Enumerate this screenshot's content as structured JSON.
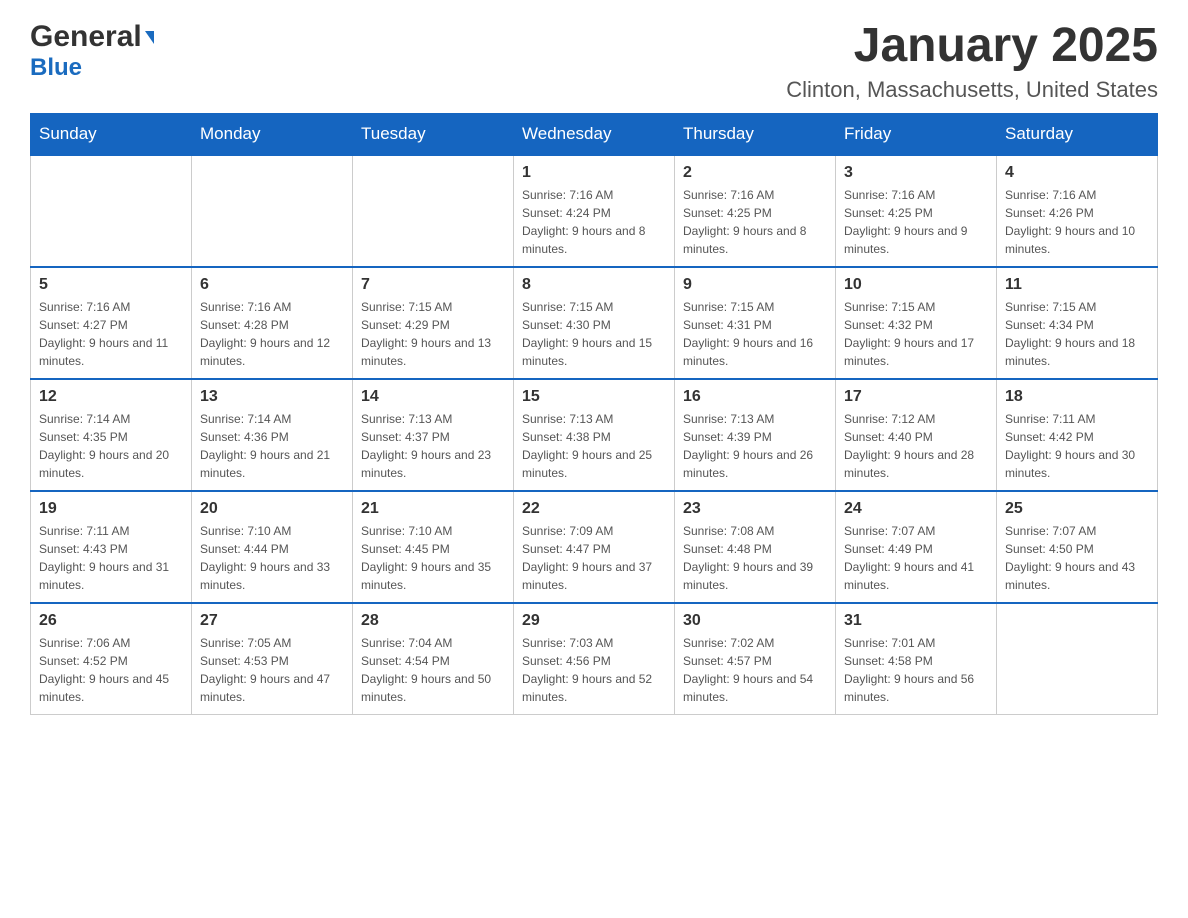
{
  "header": {
    "logo_general": "General",
    "logo_blue": "Blue",
    "title": "January 2025",
    "subtitle": "Clinton, Massachusetts, United States"
  },
  "weekdays": [
    "Sunday",
    "Monday",
    "Tuesday",
    "Wednesday",
    "Thursday",
    "Friday",
    "Saturday"
  ],
  "weeks": [
    [
      {
        "day": "",
        "sunrise": "",
        "sunset": "",
        "daylight": ""
      },
      {
        "day": "",
        "sunrise": "",
        "sunset": "",
        "daylight": ""
      },
      {
        "day": "",
        "sunrise": "",
        "sunset": "",
        "daylight": ""
      },
      {
        "day": "1",
        "sunrise": "Sunrise: 7:16 AM",
        "sunset": "Sunset: 4:24 PM",
        "daylight": "Daylight: 9 hours and 8 minutes."
      },
      {
        "day": "2",
        "sunrise": "Sunrise: 7:16 AM",
        "sunset": "Sunset: 4:25 PM",
        "daylight": "Daylight: 9 hours and 8 minutes."
      },
      {
        "day": "3",
        "sunrise": "Sunrise: 7:16 AM",
        "sunset": "Sunset: 4:25 PM",
        "daylight": "Daylight: 9 hours and 9 minutes."
      },
      {
        "day": "4",
        "sunrise": "Sunrise: 7:16 AM",
        "sunset": "Sunset: 4:26 PM",
        "daylight": "Daylight: 9 hours and 10 minutes."
      }
    ],
    [
      {
        "day": "5",
        "sunrise": "Sunrise: 7:16 AM",
        "sunset": "Sunset: 4:27 PM",
        "daylight": "Daylight: 9 hours and 11 minutes."
      },
      {
        "day": "6",
        "sunrise": "Sunrise: 7:16 AM",
        "sunset": "Sunset: 4:28 PM",
        "daylight": "Daylight: 9 hours and 12 minutes."
      },
      {
        "day": "7",
        "sunrise": "Sunrise: 7:15 AM",
        "sunset": "Sunset: 4:29 PM",
        "daylight": "Daylight: 9 hours and 13 minutes."
      },
      {
        "day": "8",
        "sunrise": "Sunrise: 7:15 AM",
        "sunset": "Sunset: 4:30 PM",
        "daylight": "Daylight: 9 hours and 15 minutes."
      },
      {
        "day": "9",
        "sunrise": "Sunrise: 7:15 AM",
        "sunset": "Sunset: 4:31 PM",
        "daylight": "Daylight: 9 hours and 16 minutes."
      },
      {
        "day": "10",
        "sunrise": "Sunrise: 7:15 AM",
        "sunset": "Sunset: 4:32 PM",
        "daylight": "Daylight: 9 hours and 17 minutes."
      },
      {
        "day": "11",
        "sunrise": "Sunrise: 7:15 AM",
        "sunset": "Sunset: 4:34 PM",
        "daylight": "Daylight: 9 hours and 18 minutes."
      }
    ],
    [
      {
        "day": "12",
        "sunrise": "Sunrise: 7:14 AM",
        "sunset": "Sunset: 4:35 PM",
        "daylight": "Daylight: 9 hours and 20 minutes."
      },
      {
        "day": "13",
        "sunrise": "Sunrise: 7:14 AM",
        "sunset": "Sunset: 4:36 PM",
        "daylight": "Daylight: 9 hours and 21 minutes."
      },
      {
        "day": "14",
        "sunrise": "Sunrise: 7:13 AM",
        "sunset": "Sunset: 4:37 PM",
        "daylight": "Daylight: 9 hours and 23 minutes."
      },
      {
        "day": "15",
        "sunrise": "Sunrise: 7:13 AM",
        "sunset": "Sunset: 4:38 PM",
        "daylight": "Daylight: 9 hours and 25 minutes."
      },
      {
        "day": "16",
        "sunrise": "Sunrise: 7:13 AM",
        "sunset": "Sunset: 4:39 PM",
        "daylight": "Daylight: 9 hours and 26 minutes."
      },
      {
        "day": "17",
        "sunrise": "Sunrise: 7:12 AM",
        "sunset": "Sunset: 4:40 PM",
        "daylight": "Daylight: 9 hours and 28 minutes."
      },
      {
        "day": "18",
        "sunrise": "Sunrise: 7:11 AM",
        "sunset": "Sunset: 4:42 PM",
        "daylight": "Daylight: 9 hours and 30 minutes."
      }
    ],
    [
      {
        "day": "19",
        "sunrise": "Sunrise: 7:11 AM",
        "sunset": "Sunset: 4:43 PM",
        "daylight": "Daylight: 9 hours and 31 minutes."
      },
      {
        "day": "20",
        "sunrise": "Sunrise: 7:10 AM",
        "sunset": "Sunset: 4:44 PM",
        "daylight": "Daylight: 9 hours and 33 minutes."
      },
      {
        "day": "21",
        "sunrise": "Sunrise: 7:10 AM",
        "sunset": "Sunset: 4:45 PM",
        "daylight": "Daylight: 9 hours and 35 minutes."
      },
      {
        "day": "22",
        "sunrise": "Sunrise: 7:09 AM",
        "sunset": "Sunset: 4:47 PM",
        "daylight": "Daylight: 9 hours and 37 minutes."
      },
      {
        "day": "23",
        "sunrise": "Sunrise: 7:08 AM",
        "sunset": "Sunset: 4:48 PM",
        "daylight": "Daylight: 9 hours and 39 minutes."
      },
      {
        "day": "24",
        "sunrise": "Sunrise: 7:07 AM",
        "sunset": "Sunset: 4:49 PM",
        "daylight": "Daylight: 9 hours and 41 minutes."
      },
      {
        "day": "25",
        "sunrise": "Sunrise: 7:07 AM",
        "sunset": "Sunset: 4:50 PM",
        "daylight": "Daylight: 9 hours and 43 minutes."
      }
    ],
    [
      {
        "day": "26",
        "sunrise": "Sunrise: 7:06 AM",
        "sunset": "Sunset: 4:52 PM",
        "daylight": "Daylight: 9 hours and 45 minutes."
      },
      {
        "day": "27",
        "sunrise": "Sunrise: 7:05 AM",
        "sunset": "Sunset: 4:53 PM",
        "daylight": "Daylight: 9 hours and 47 minutes."
      },
      {
        "day": "28",
        "sunrise": "Sunrise: 7:04 AM",
        "sunset": "Sunset: 4:54 PM",
        "daylight": "Daylight: 9 hours and 50 minutes."
      },
      {
        "day": "29",
        "sunrise": "Sunrise: 7:03 AM",
        "sunset": "Sunset: 4:56 PM",
        "daylight": "Daylight: 9 hours and 52 minutes."
      },
      {
        "day": "30",
        "sunrise": "Sunrise: 7:02 AM",
        "sunset": "Sunset: 4:57 PM",
        "daylight": "Daylight: 9 hours and 54 minutes."
      },
      {
        "day": "31",
        "sunrise": "Sunrise: 7:01 AM",
        "sunset": "Sunset: 4:58 PM",
        "daylight": "Daylight: 9 hours and 56 minutes."
      },
      {
        "day": "",
        "sunrise": "",
        "sunset": "",
        "daylight": ""
      }
    ]
  ],
  "colors": {
    "header_bg": "#1565c0",
    "header_text": "#ffffff",
    "border_top": "#1565c0",
    "cell_border": "#cccccc"
  }
}
